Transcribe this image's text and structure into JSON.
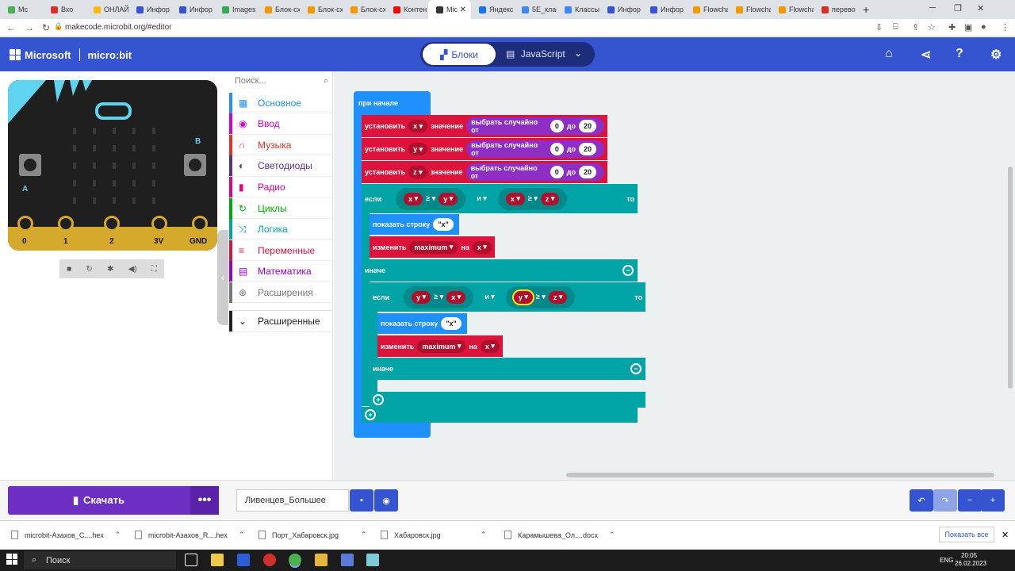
{
  "browser": {
    "tabs": [
      {
        "label": "Mc",
        "color": "#4caf50"
      },
      {
        "label": "Вхо",
        "color": "#d93025"
      },
      {
        "label": "ОНЛАЙ",
        "color": "#fbbc04"
      },
      {
        "label": "Инфор",
        "color": "#3454d1"
      },
      {
        "label": "Инфор",
        "color": "#3454d1"
      },
      {
        "label": "Images",
        "color": "#34a853"
      },
      {
        "label": "Блок-сх",
        "color": "#f29900"
      },
      {
        "label": "Блок-сх",
        "color": "#f29900"
      },
      {
        "label": "Блок-сх",
        "color": "#f29900"
      },
      {
        "label": "Контен",
        "color": "#ff0000"
      },
      {
        "label": "Mic",
        "color": "#333333"
      },
      {
        "label": "Яндекс",
        "color": "#1a73e8"
      },
      {
        "label": "5E_клас",
        "color": "#4285f4"
      },
      {
        "label": "Классы",
        "color": "#4285f4"
      },
      {
        "label": "Инфор",
        "color": "#3454d1"
      },
      {
        "label": "Инфор",
        "color": "#3454d1"
      },
      {
        "label": "Flowcha",
        "color": "#f29900"
      },
      {
        "label": "Flowcha",
        "color": "#f29900"
      },
      {
        "label": "Flowcha",
        "color": "#f29900"
      },
      {
        "label": "перево",
        "color": "#d93025"
      }
    ],
    "url": "makecode.microbit.org/#editor"
  },
  "header": {
    "brand": "Microsoft",
    "product": "micro:bit",
    "blocks_label": "Блоки",
    "js_label": "JavaScript"
  },
  "simulator": {
    "pins": [
      "0",
      "1",
      "2",
      "3V",
      "GND"
    ],
    "btn_a": "A",
    "btn_b": "B"
  },
  "toolbox": {
    "search_placeholder": "Поиск...",
    "categories": [
      {
        "label": "Основное",
        "color": "#1e90ff",
        "icon": "grid-icon"
      },
      {
        "label": "Ввод",
        "color": "#d400d4",
        "icon": "circle-icon"
      },
      {
        "label": "Музыка",
        "color": "#e63022",
        "icon": "headphones-icon"
      },
      {
        "label": "Светодиоды",
        "color": "#5c2d91",
        "icon": "toggle-icon"
      },
      {
        "label": "Радио",
        "color": "#e3008c",
        "icon": "signal-icon"
      },
      {
        "label": "Циклы",
        "color": "#00aa00",
        "icon": "refresh-icon"
      },
      {
        "label": "Логика",
        "color": "#00a4a6",
        "icon": "shuffle-icon"
      },
      {
        "label": "Переменные",
        "color": "#dc143c",
        "icon": "list-icon"
      },
      {
        "label": "Математика",
        "color": "#9400d3",
        "icon": "calculator-icon"
      },
      {
        "label": "Расширения",
        "color": "#777777",
        "icon": "plus-icon"
      },
      {
        "label": "Расширенные",
        "color": "#222222",
        "icon": "chevron-down-icon"
      }
    ]
  },
  "blocks": {
    "on_start": "при начале",
    "set": "установить",
    "value": "значение",
    "pick_random": "выбрать случайно от",
    "to": "до",
    "var_x": "x",
    "var_y": "y",
    "var_z": "z",
    "n0": "0",
    "n20": "20",
    "if": "если",
    "ge": "≥",
    "and": "и",
    "then": "то",
    "show_string": "показать строку",
    "str_x": "\"x\"",
    "change": "изменить",
    "maximum": "maximum",
    "by": "на",
    "else": "иначе"
  },
  "bottom": {
    "download_label": "Скачать",
    "project_name": "Ливенцев_Большее"
  },
  "downloads": {
    "items": [
      "microbit-Азахов_С....hex",
      "microbit-Азахов_R....hex",
      "Порт_Хабаровск.jpg",
      "Хабаровск.jpg",
      "Карамышева_Ол....docx"
    ],
    "show_all": "Показать все"
  },
  "taskbar": {
    "search_label": "Поиск",
    "lang": "ENG",
    "time": "20:05",
    "date": "26.02.2023"
  }
}
